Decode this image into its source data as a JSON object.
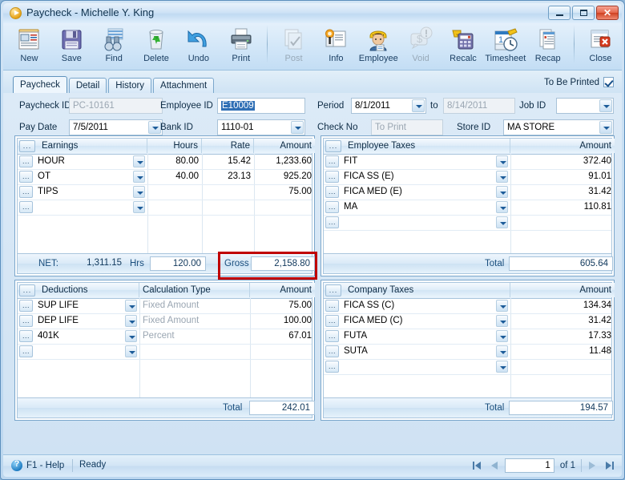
{
  "window": {
    "title": "Paycheck - Michelle Y. King",
    "icon": "play-circle-icon",
    "buttons": {
      "minimize": "minimize-icon",
      "maximize": "maximize-icon",
      "close": "close-icon"
    }
  },
  "toolbar": {
    "items": [
      {
        "label": "New",
        "icon": "new-document-icon",
        "disabled": false
      },
      {
        "label": "Save",
        "icon": "floppy-disk-icon",
        "disabled": false
      },
      {
        "label": "Find",
        "icon": "binoculars-icon",
        "disabled": false
      },
      {
        "label": "Delete",
        "icon": "recycle-bin-icon",
        "disabled": false
      },
      {
        "label": "Undo",
        "icon": "undo-arrow-icon",
        "disabled": false
      },
      {
        "label": "Print",
        "icon": "printer-icon",
        "disabled": false
      },
      {
        "label": "Post",
        "icon": "post-document-icon",
        "disabled": true
      },
      {
        "label": "Info",
        "icon": "info-document-icon",
        "disabled": false
      },
      {
        "label": "Employee",
        "icon": "employee-badge-icon",
        "disabled": false
      },
      {
        "label": "Void",
        "icon": "void-dollar-icon",
        "disabled": true
      },
      {
        "label": "Recalc",
        "icon": "calculator-icon",
        "disabled": false
      },
      {
        "label": "Timesheet",
        "icon": "timesheet-clock-icon",
        "disabled": false
      },
      {
        "label": "Recap",
        "icon": "recap-pages-icon",
        "disabled": false
      },
      {
        "label": "Close",
        "icon": "close-document-icon",
        "disabled": false
      }
    ],
    "separator_after": [
      5,
      12
    ]
  },
  "tabs": {
    "items": [
      "Paycheck",
      "Detail",
      "History",
      "Attachment"
    ],
    "active_index": 0,
    "to_be_printed_label": "To Be Printed",
    "to_be_printed_checked": true
  },
  "form": {
    "paycheck_id_label": "Paycheck ID",
    "paycheck_id_value": "PC-10161",
    "employee_id_label": "Employee ID",
    "employee_id_value": "E10009",
    "employee_id_selected_prefix": "E",
    "employee_id_selected_rest": "10009",
    "period_label": "Period",
    "period_from": "8/1/2011",
    "period_to_label": "to",
    "period_to": "8/14/2011",
    "job_id_label": "Job ID",
    "job_id_value": "",
    "pay_date_label": "Pay Date",
    "pay_date_value": "7/5/2011",
    "bank_id_label": "Bank ID",
    "bank_id_value": "1110-01",
    "check_no_label": "Check No",
    "check_no_placeholder": "To Print",
    "store_id_label": "Store ID",
    "store_id_value": "MA STORE"
  },
  "earnings": {
    "headers": [
      "Earnings",
      "Hours",
      "Rate",
      "Amount"
    ],
    "rows": [
      {
        "code": "HOUR",
        "hours": "80.00",
        "rate": "15.42",
        "amount": "1,233.60"
      },
      {
        "code": "OT",
        "hours": "40.00",
        "rate": "23.13",
        "amount": "925.20"
      },
      {
        "code": "TIPS",
        "hours": "",
        "rate": "",
        "amount": "75.00"
      },
      {
        "code": "",
        "hours": "",
        "rate": "",
        "amount": ""
      }
    ],
    "footer": {
      "net_label": "NET:",
      "net_value": "1,311.15",
      "hrs_label": "Hrs",
      "hrs_value": "120.00",
      "gross_label": "Gross",
      "gross_value": "2,158.80",
      "gross_highlight_color": "#c00000"
    }
  },
  "employee_taxes": {
    "headers": [
      "Employee Taxes",
      "Amount"
    ],
    "rows": [
      {
        "code": "FIT",
        "amount": "372.40"
      },
      {
        "code": "FICA SS (E)",
        "amount": "91.01"
      },
      {
        "code": "FICA MED (E)",
        "amount": "31.42"
      },
      {
        "code": "MA",
        "amount": "110.81"
      },
      {
        "code": "",
        "amount": ""
      }
    ],
    "footer": {
      "total_label": "Total",
      "total_value": "605.64"
    }
  },
  "deductions": {
    "headers": [
      "Deductions",
      "Calculation Type",
      "Amount"
    ],
    "rows": [
      {
        "code": "SUP LIFE",
        "calc": "Fixed Amount",
        "amount": "75.00"
      },
      {
        "code": "DEP LIFE",
        "calc": "Fixed Amount",
        "amount": "100.00"
      },
      {
        "code": "401K",
        "calc": "Percent",
        "amount": "67.01"
      },
      {
        "code": "",
        "calc": "",
        "amount": ""
      }
    ],
    "footer": {
      "total_label": "Total",
      "total_value": "242.01"
    }
  },
  "company_taxes": {
    "headers": [
      "Company Taxes",
      "Amount"
    ],
    "rows": [
      {
        "code": "FICA SS (C)",
        "amount": "134.34"
      },
      {
        "code": "FICA MED (C)",
        "amount": "31.42"
      },
      {
        "code": "FUTA",
        "amount": "17.33"
      },
      {
        "code": "SUTA",
        "amount": "11.48"
      },
      {
        "code": "",
        "amount": ""
      }
    ],
    "footer": {
      "total_label": "Total",
      "total_value": "194.57"
    }
  },
  "statusbar": {
    "help_label": "F1 - Help",
    "help_icon": "help-circle-icon",
    "status": "Ready",
    "page_value": "1",
    "of_label": "of 1",
    "first_icon": "first-page-icon",
    "prev_icon": "previous-page-icon",
    "next_icon": "next-page-icon",
    "last_icon": "last-page-icon"
  },
  "grid_row_button": "...",
  "grid_header_button": "..."
}
